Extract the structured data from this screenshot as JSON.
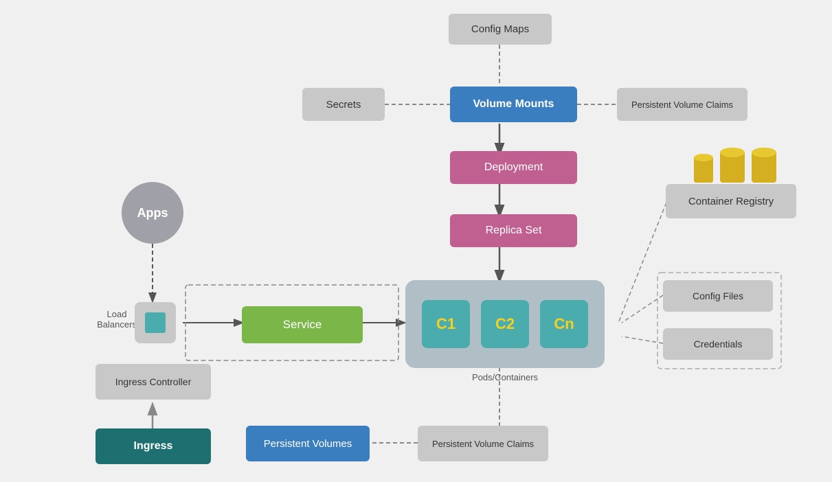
{
  "nodes": {
    "config_maps": {
      "label": "Config Maps"
    },
    "secrets": {
      "label": "Secrets"
    },
    "volume_mounts": {
      "label": "Volume Mounts"
    },
    "persistent_volume_claims_top": {
      "label": "Persistent Volume Claims"
    },
    "deployment": {
      "label": "Deployment"
    },
    "replica_set": {
      "label": "Replica Set"
    },
    "service": {
      "label": "Service"
    },
    "apps": {
      "label": "Apps"
    },
    "load_balancers": {
      "label": "Load Balancers"
    },
    "ingress_controller": {
      "label": "Ingress Controller"
    },
    "ingress": {
      "label": "Ingress"
    },
    "persistent_volumes": {
      "label": "Persistent Volumes"
    },
    "persistent_volume_claims_bottom": {
      "label": "Persistent Volume Claims"
    },
    "container_registry": {
      "label": "Container Registry"
    },
    "config_files": {
      "label": "Config Files"
    },
    "credentials": {
      "label": "Credentials"
    },
    "pods_containers_label": {
      "label": "Pods/Containers"
    },
    "pod_c1": {
      "label": "C1"
    },
    "pod_c2": {
      "label": "C2"
    },
    "pod_cn": {
      "label": "Cn"
    }
  },
  "colors": {
    "gray": "#c8c8c8",
    "blue": "#3a7ebf",
    "pink": "#c06090",
    "green": "#7ab648",
    "teal": "#4aacac",
    "teal_dark": "#2e7070",
    "yellow": "#f5d020",
    "dark_teal": "#1e6e6e"
  }
}
